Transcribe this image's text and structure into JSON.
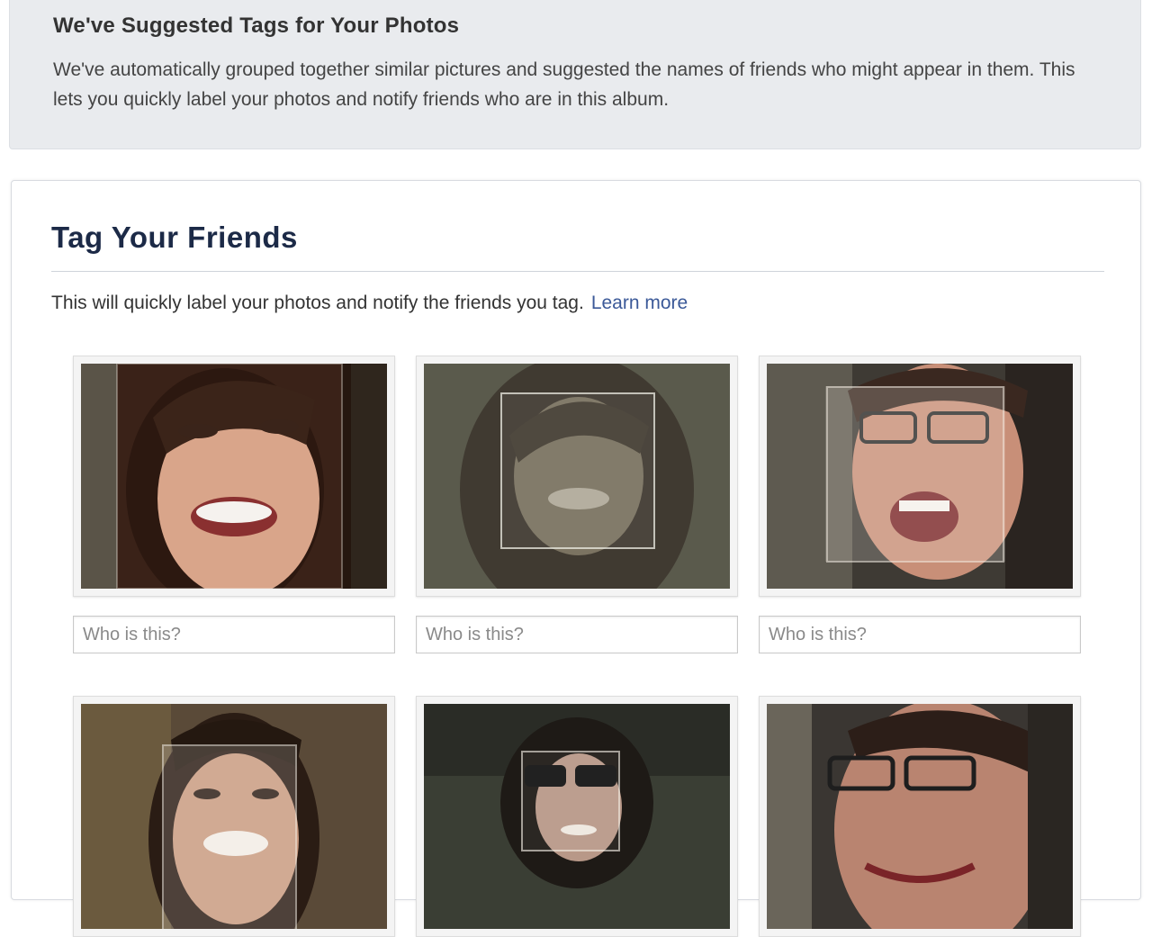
{
  "banner": {
    "title": "We've Suggested Tags for Your Photos",
    "description": "We've automatically grouped together similar pictures and suggested the names of friends who might appear in them. This lets you quickly label your photos and notify friends who are in this album."
  },
  "tagging": {
    "title": "Tag Your Friends",
    "intro": "This will quickly label your photos and notify the friends you tag.",
    "learn_more": "Learn more",
    "placeholder": "Who is this?"
  },
  "colors": {
    "link": "#3b5998",
    "banner_background": "#e9ebee",
    "heading": "#1c2a47"
  }
}
